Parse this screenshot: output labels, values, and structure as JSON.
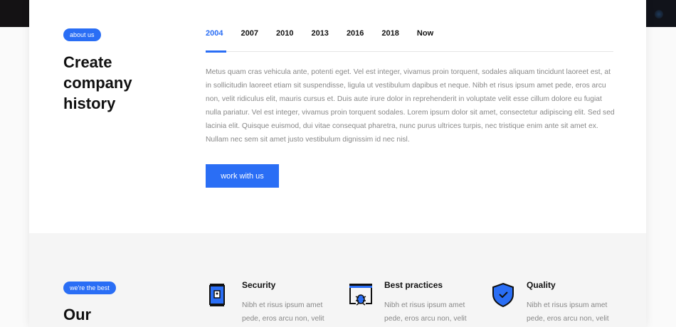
{
  "about": {
    "badge": "about us",
    "title": [
      "Create",
      "company",
      "history"
    ]
  },
  "timeline": {
    "tabs": [
      "2004",
      "2007",
      "2010",
      "2013",
      "2016",
      "2018",
      "Now"
    ],
    "active": "2004",
    "text": "Metus quam cras vehicula ante, potenti eget. Vel est integer, vivamus proin torquent, sodales aliquam tincidunt laoreet est, at in sollicitudin laoreet etiam sit suspendisse, ligula ut vestibulum dapibus et neque. Nibh et risus ipsum amet pede, eros arcu non, velit ridiculus elit, mauris cursus et. Duis aute irure dolor in reprehenderit in voluptate velit esse cillum dolore eu fugiat nulla pariatur. Vel est integer, vivamus proin torquent sodales. Lorem ipsum dolor sit amet, consectetur adipiscing elit. Sed sed lacinia elit. Quisque euismod, dui vitae consequat pharetra, nunc purus ultrices turpis, nec tristique enim ante sit amet ex. Nullam nec sem sit amet justo vestibulum dignissim id nec nisl.",
    "button": "work with us"
  },
  "best": {
    "badge": "we're the best",
    "title": "Our",
    "features": [
      {
        "icon": "lock-door-icon",
        "title": "Security",
        "text": "Nibh et risus ipsum amet pede, eros arcu non, velit"
      },
      {
        "icon": "bug-browser-icon",
        "title": "Best practices",
        "text": "Nibh et risus ipsum amet pede, eros arcu non, velit"
      },
      {
        "icon": "shield-check-icon",
        "title": "Quality",
        "text": "Nibh et risus ipsum amet pede, eros arcu non, velit"
      }
    ]
  },
  "colors": {
    "accent": "#2a6ef5"
  }
}
